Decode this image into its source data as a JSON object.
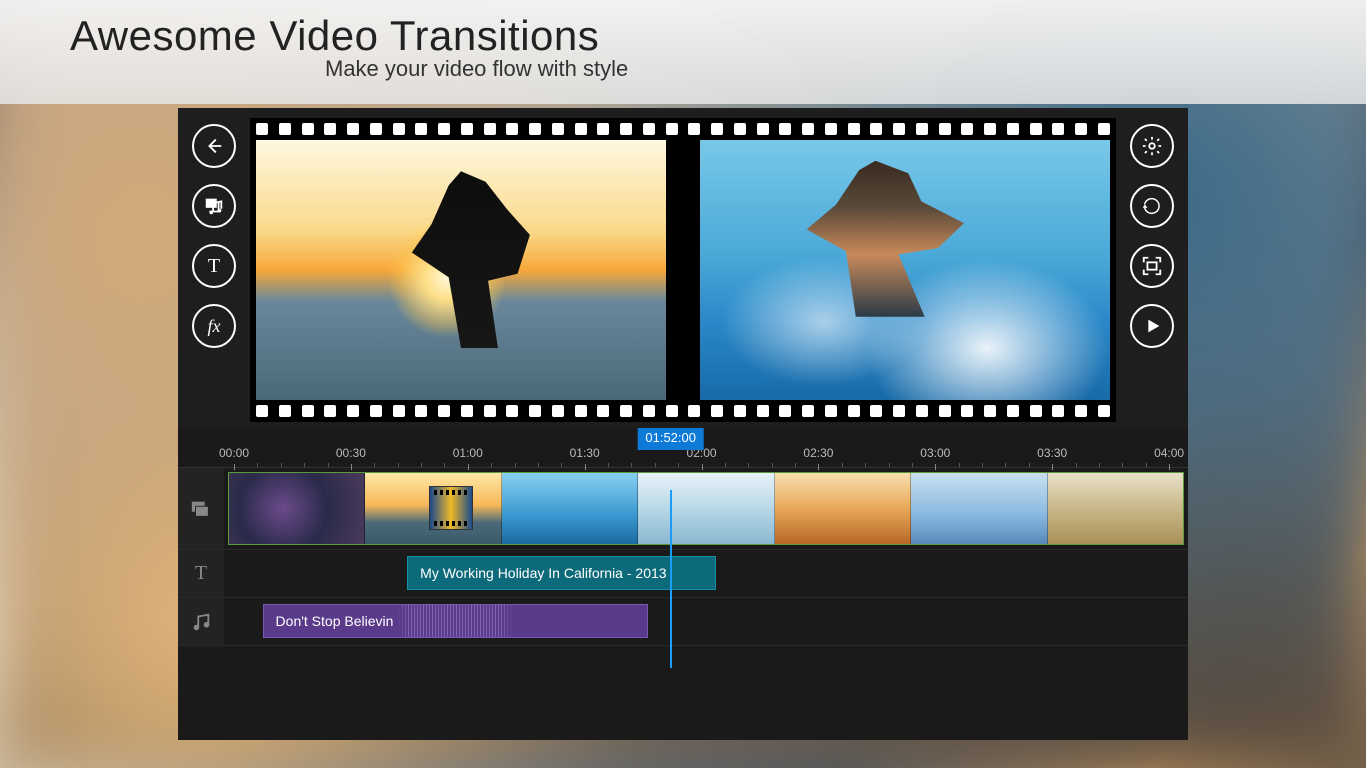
{
  "banner": {
    "title": "Awesome Video Transitions",
    "subtitle": "Make your video flow with style"
  },
  "left_tools": {
    "back": "Back",
    "media": "Media Library",
    "text": "Titles",
    "fx": "Effects"
  },
  "right_tools": {
    "settings": "Settings",
    "undo": "Undo",
    "fullscreen": "Fullscreen",
    "play": "Play"
  },
  "timeline": {
    "ruler": [
      "00:00",
      "00:30",
      "01:00",
      "01:30",
      "02:00",
      "02:30",
      "03:00",
      "03:30",
      "04:00"
    ],
    "playhead_time": "01:52:00",
    "playhead_pct": 46.7,
    "title_clip": {
      "label": "My Working Holiday In California - 2013",
      "start_pct": 19,
      "width_pct": 32
    },
    "audio_clip": {
      "label": "Don't Stop Believin",
      "start_pct": 4,
      "width_pct": 40
    },
    "transition_pct": 23.5
  },
  "tracks": {
    "video": "Video",
    "text": "Title",
    "audio": "Audio"
  }
}
